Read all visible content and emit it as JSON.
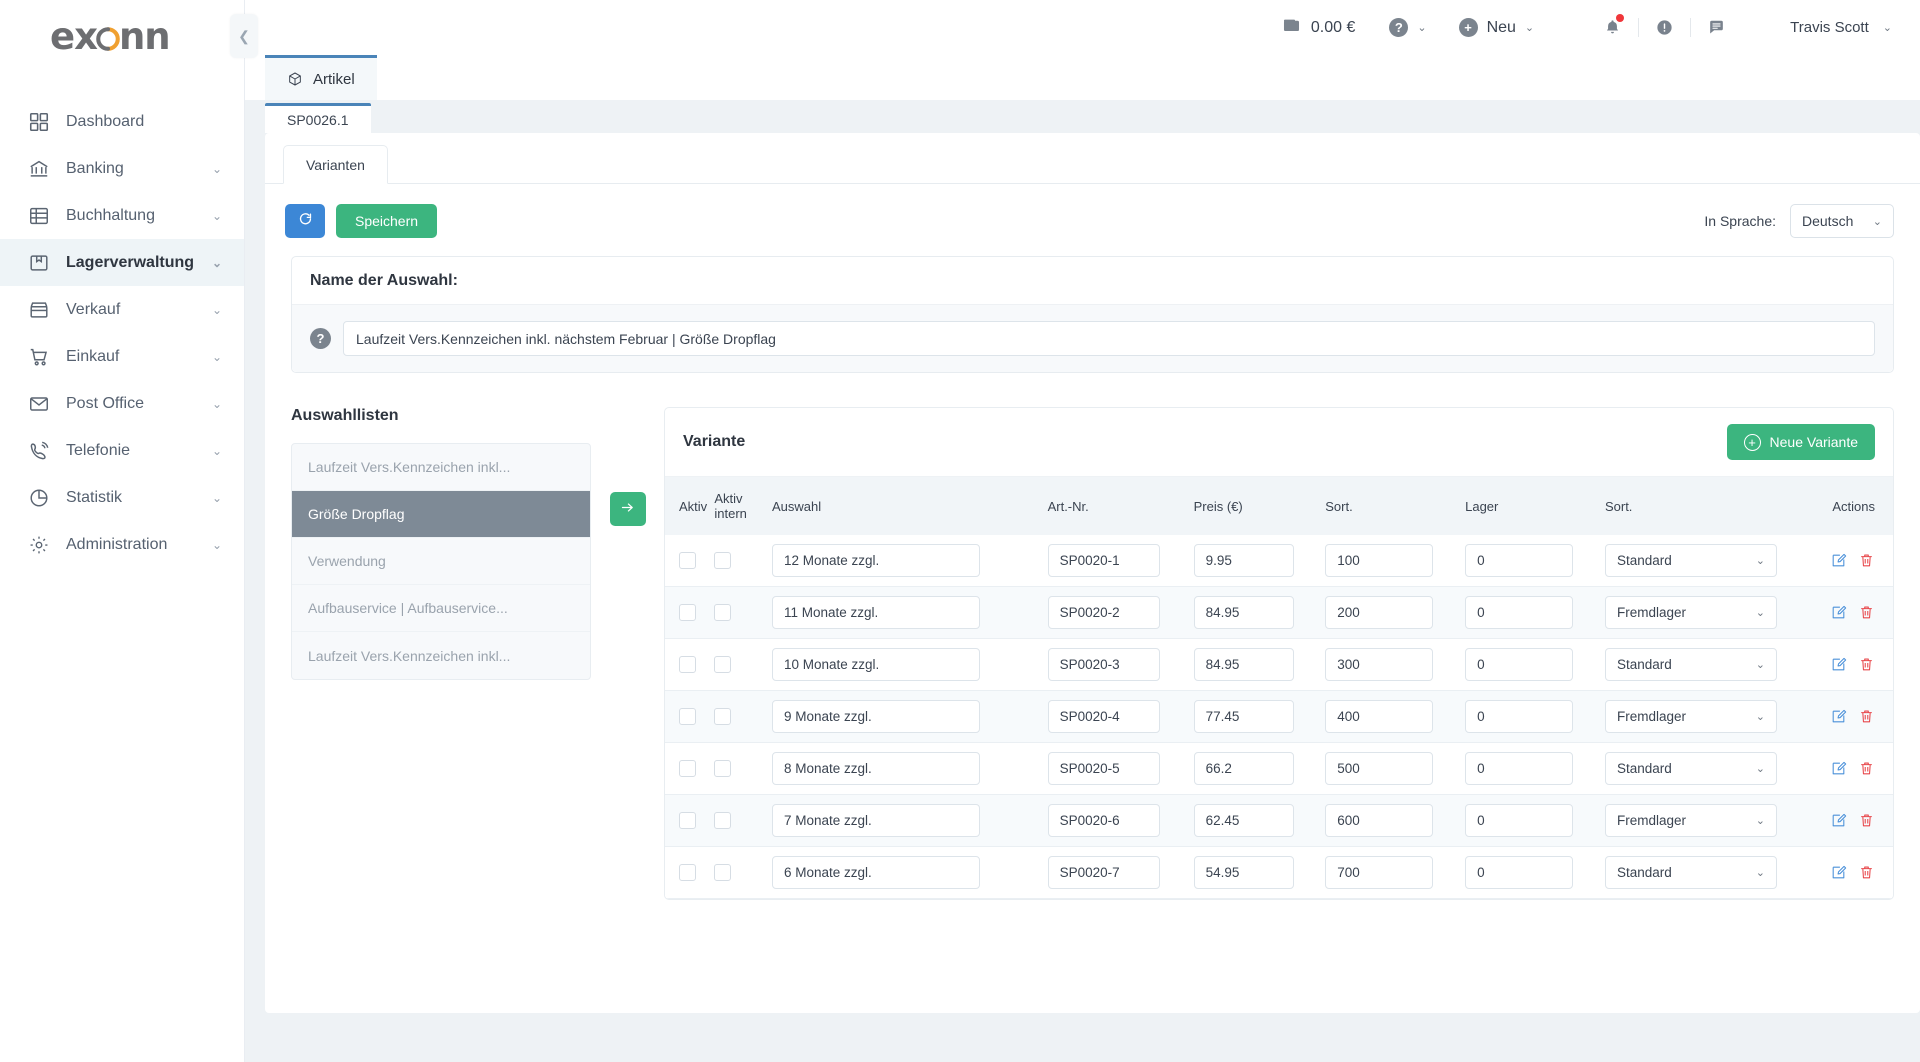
{
  "brand": {
    "name": "exonn",
    "accent": "#f0a030",
    "logo_color": "#6d6e71"
  },
  "sidebar": {
    "collapse_icon": "chevron-left-icon",
    "items": [
      {
        "label": "Dashboard",
        "icon": "grid-icon",
        "expandable": false,
        "active": false
      },
      {
        "label": "Banking",
        "icon": "bank-icon",
        "expandable": true,
        "active": false
      },
      {
        "label": "Buchhaltung",
        "icon": "ledger-icon",
        "expandable": true,
        "active": false
      },
      {
        "label": "Lagerverwaltung",
        "icon": "box-icon",
        "expandable": true,
        "active": true
      },
      {
        "label": "Verkauf",
        "icon": "store-icon",
        "expandable": true,
        "active": false
      },
      {
        "label": "Einkauf",
        "icon": "cart-icon",
        "expandable": true,
        "active": false
      },
      {
        "label": "Post Office",
        "icon": "envelope-icon",
        "expandable": true,
        "active": false
      },
      {
        "label": "Telefonie",
        "icon": "phone-icon",
        "expandable": true,
        "active": false
      },
      {
        "label": "Statistik",
        "icon": "pie-chart-icon",
        "expandable": true,
        "active": false
      },
      {
        "label": "Administration",
        "icon": "gear-icon",
        "expandable": true,
        "active": false
      }
    ]
  },
  "topbar": {
    "wallet_icon": "wallet-icon",
    "balance": "0.00 €",
    "help_icon": "question-circle-icon",
    "new_icon": "plus-circle-icon",
    "new_label": "Neu",
    "bell_icon": "bell-icon",
    "alert_icon": "exclamation-circle-icon",
    "notes_icon": "note-icon",
    "user_name": "Travis Scott",
    "caret": "⌄"
  },
  "tabs": {
    "main_tab": {
      "label": "Artikel",
      "icon": "cube-icon"
    },
    "doc_tab": {
      "label": "SP0026.1"
    },
    "inner_tab": {
      "label": "Varianten"
    }
  },
  "toolbar": {
    "refresh_icon": "refresh-icon",
    "save_label": "Speichern",
    "language_label": "In Sprache:",
    "language_value": "Deutsch"
  },
  "selection_card": {
    "title": "Name der Auswahl:",
    "help_icon": "question-mark-icon",
    "input_value": "Laufzeit Vers.Kennzeichen inkl. nächstem Februar | Größe Dropflag",
    "input_placeholder": ""
  },
  "selection_lists": {
    "title": "Auswahllisten",
    "items": [
      {
        "label": "Laufzeit Vers.Kennzeichen inkl...",
        "selected": false
      },
      {
        "label": "Größe Dropflag",
        "selected": true
      },
      {
        "label": "Verwendung",
        "selected": false
      },
      {
        "label": "Aufbauservice | Aufbauservice...",
        "selected": false
      },
      {
        "label": "Laufzeit Vers.Kennzeichen inkl...",
        "selected": false
      }
    ],
    "move_button_icon": "arrow-right-icon"
  },
  "variant_panel": {
    "title": "Variante",
    "new_button_label": "Neue Variante",
    "new_button_icon": "plus-circle-outline-icon",
    "columns": [
      "Aktiv",
      "Aktiv intern",
      "Auswahl",
      "Art.-Nr.",
      "Preis (€)",
      "Sort.",
      "Lager",
      "Sort.",
      "Actions"
    ],
    "rows": [
      {
        "aktiv": false,
        "aktiv_intern": false,
        "auswahl": "12 Monate zzgl.",
        "artnr": "SP0020-1",
        "preis": "9.95",
        "sort1": "100",
        "lager": "0",
        "sort2": "Standard"
      },
      {
        "aktiv": false,
        "aktiv_intern": false,
        "auswahl": "11 Monate zzgl.",
        "artnr": "SP0020-2",
        "preis": "84.95",
        "sort1": "200",
        "lager": "0",
        "sort2": "Fremdlager"
      },
      {
        "aktiv": false,
        "aktiv_intern": false,
        "auswahl": "10 Monate zzgl.",
        "artnr": "SP0020-3",
        "preis": "84.95",
        "sort1": "300",
        "lager": "0",
        "sort2": "Standard"
      },
      {
        "aktiv": false,
        "aktiv_intern": false,
        "auswahl": "9 Monate zzgl.",
        "artnr": "SP0020-4",
        "preis": "77.45",
        "sort1": "400",
        "lager": "0",
        "sort2": "Fremdlager"
      },
      {
        "aktiv": false,
        "aktiv_intern": false,
        "auswahl": "8 Monate zzgl.",
        "artnr": "SP0020-5",
        "preis": "66.2",
        "sort1": "500",
        "lager": "0",
        "sort2": "Standard"
      },
      {
        "aktiv": false,
        "aktiv_intern": false,
        "auswahl": "7 Monate zzgl.",
        "artnr": "SP0020-6",
        "preis": "62.45",
        "sort1": "600",
        "lager": "0",
        "sort2": "Fremdlager"
      },
      {
        "aktiv": false,
        "aktiv_intern": false,
        "auswahl": "6 Monate zzgl.",
        "artnr": "SP0020-7",
        "preis": "54.95",
        "sort1": "700",
        "lager": "0",
        "sort2": "Standard"
      }
    ],
    "row_actions": {
      "edit_icon": "edit-icon",
      "delete_icon": "trash-icon"
    }
  },
  "colors": {
    "primary_green": "#3cb57f",
    "primary_blue": "#3c87d6",
    "danger_red": "#e8474b",
    "tab_accent": "#4a84b8"
  }
}
